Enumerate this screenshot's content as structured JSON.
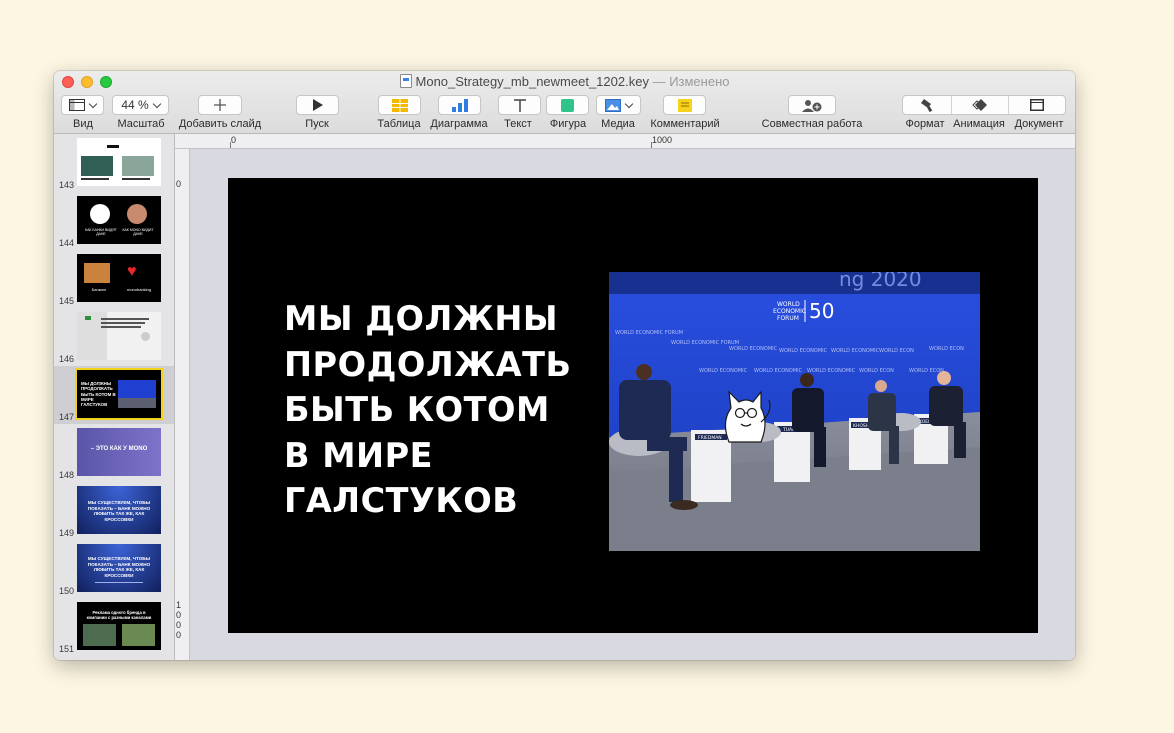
{
  "window": {
    "filename": "Mono_Strategy_mb_newmeet_1202.key",
    "status": "— Изменено"
  },
  "toolbar": {
    "view_label": "Вид",
    "zoom_value": "44 %",
    "zoom_label": "Масштаб",
    "add_slide_label": "Добавить слайд",
    "play_label": "Пуск",
    "table_label": "Таблица",
    "chart_label": "Диаграмма",
    "text_label": "Текст",
    "shape_label": "Фигура",
    "media_label": "Медиа",
    "comment_label": "Комментарий",
    "collaborate_label": "Совместная работа",
    "format_label": "Формат",
    "animate_label": "Анимация",
    "document_label": "Документ"
  },
  "rulers": {
    "h_zero": "0",
    "h_thousand": "1000",
    "v_zero": "0",
    "v_thousand": [
      "1",
      "0",
      "0",
      "0"
    ]
  },
  "slides": [
    {
      "number": "143",
      "style": "white"
    },
    {
      "number": "144",
      "style": "dark-circles",
      "left_caption": "КАК БАНКИ ВИДЯТ ДАНЕ",
      "right_caption": "КАК MONO ВИДИТ ДАНЕ"
    },
    {
      "number": "145",
      "style": "dark-heart",
      "left_caption": "Банкинг",
      "right_caption": "monobanking"
    },
    {
      "number": "146",
      "style": "white-text"
    },
    {
      "number": "147",
      "style": "dark-selected",
      "caption": "МЫ ДОЛЖНЫ ПРОДОЛЖАТЬ БЫТЬ КОТОМ В МИРЕ ГАЛСТУКОВ"
    },
    {
      "number": "148",
      "style": "purple",
      "caption": "– ЭТО КАК У MONO"
    },
    {
      "number": "149",
      "style": "blue",
      "caption": "МЫ СУЩЕСТВУЕМ, ЧТОБЫ ПОКАЗАТЬ – БАНК МОЖНО ЛЮБИТЬ ТАК ЖЕ, КАК КРОССОВКИ"
    },
    {
      "number": "150",
      "style": "blue",
      "caption": "МЫ СУЩЕСТВУЕМ, ЧТОБЫ ПОКАЗАТЬ – БАНК МОЖНО ЛЮБИТЬ ТАК ЖЕ, КАК КРОССОВКИ"
    },
    {
      "number": "151",
      "style": "dark-photos",
      "caption": "Реклама одного бренда в компании с разными каналами"
    }
  ],
  "slide": {
    "lines": [
      "МЫ ДОЛЖНЫ",
      "ПРОДОЛЖАТЬ",
      "БЫТЬ КОТОМ",
      "В МИРЕ",
      "ГАЛСТУКОВ"
    ],
    "photo": {
      "banner_text": "ng 2020",
      "wef_text": [
        "WORLD",
        "ECONOMIC",
        "FORUM"
      ],
      "fifty": "50",
      "nameplates": [
        "FRIEDMAN",
        "TUAM",
        "KHOSHR",
        "KOENIKE"
      ]
    }
  },
  "colors": {
    "selection": "#f2d21a",
    "slide_background": "#000000",
    "stage_blue": "#1f3fd0"
  }
}
